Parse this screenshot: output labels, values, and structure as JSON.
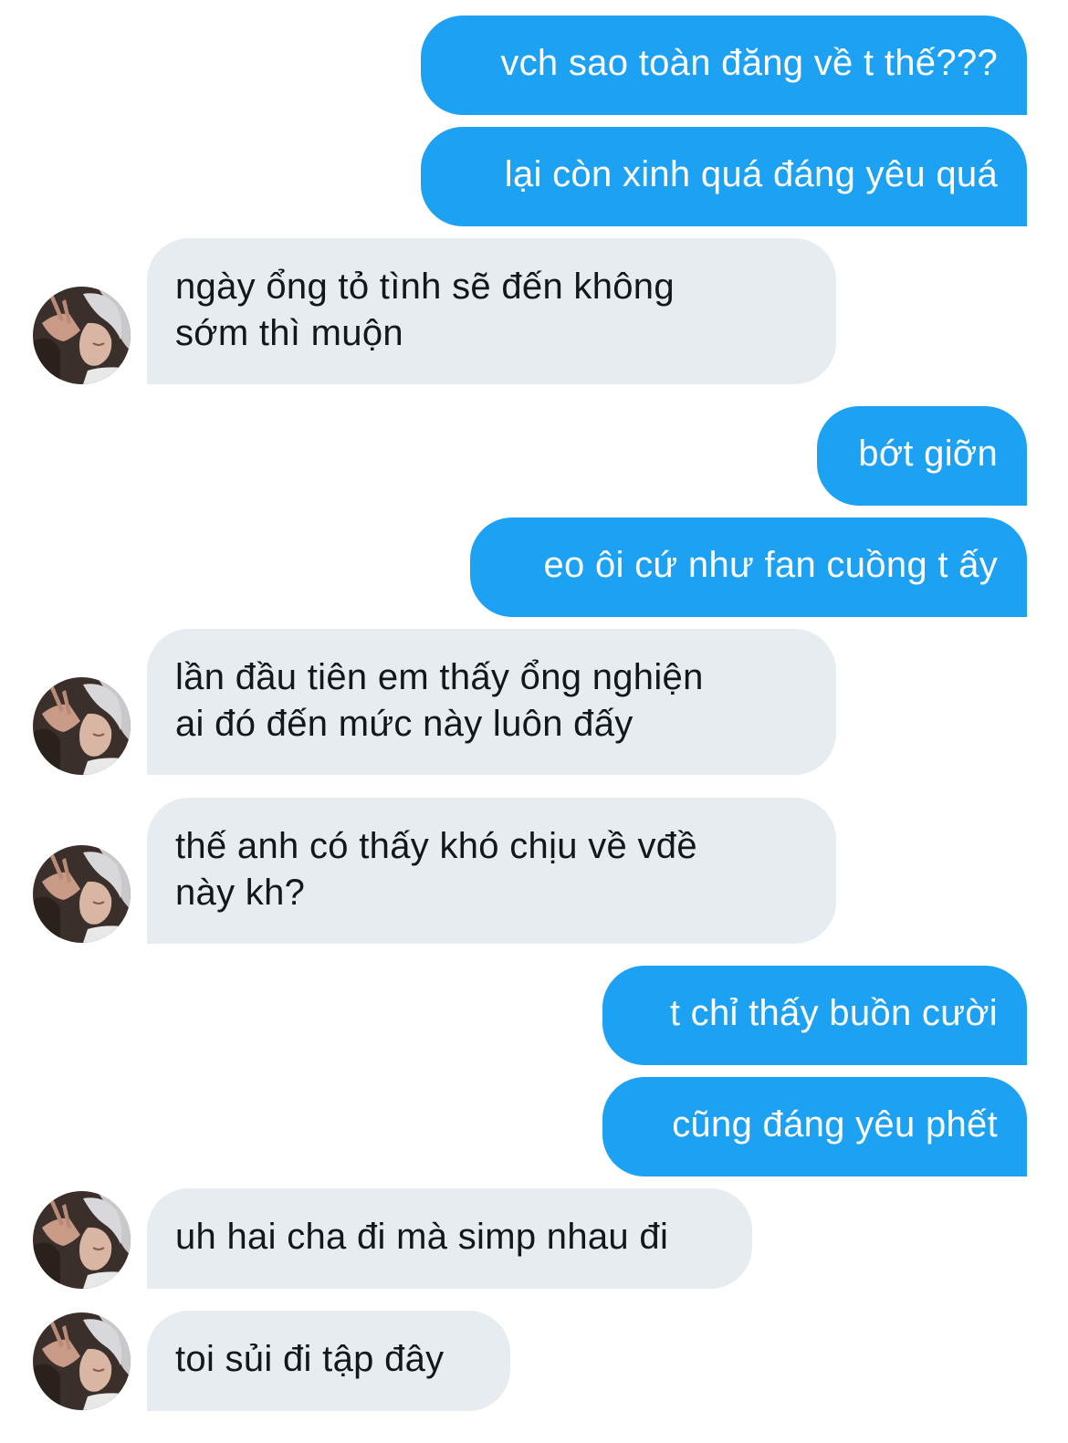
{
  "conversation": {
    "messages": [
      {
        "from": "me",
        "text": "vch sao toàn đăng về t thế???"
      },
      {
        "from": "me",
        "text": "lại còn xinh quá đáng yêu quá"
      },
      {
        "from": "other",
        "text": "ngày ổng tỏ tình sẽ đến không sớm thì muộn",
        "lines": [
          "ngày ổng tỏ tình sẽ đến không",
          "sớm thì muộn"
        ]
      },
      {
        "from": "me",
        "text": "bớt giỡn"
      },
      {
        "from": "me",
        "text": "eo ôi cứ như fan cuồng t ấy"
      },
      {
        "from": "other",
        "text": "lần đầu tiên em thấy ổng nghiện ai đó đến mức này luôn đấy",
        "lines": [
          "lần đầu tiên em thấy ổng nghiện",
          "ai đó đến mức này luôn đấy"
        ]
      },
      {
        "from": "other",
        "text": "thế anh có thấy khó chịu về vđề này kh?",
        "lines": [
          "thế anh có thấy khó chịu về vđề",
          "này kh?"
        ]
      },
      {
        "from": "me",
        "text": "t chỉ thấy buồn cười"
      },
      {
        "from": "me",
        "text": "cũng đáng yêu phết"
      },
      {
        "from": "other",
        "text": "uh hai cha đi mà simp nhau đi"
      },
      {
        "from": "other",
        "text": "toi sủi đi tập đây"
      }
    ]
  },
  "colors": {
    "outgoing_bubble": "#1da1f2",
    "incoming_bubble": "#e6ecf0",
    "outgoing_text": "#ffffff",
    "incoming_text": "#14171a"
  },
  "icons": {
    "avatar": "user-avatar-photo"
  }
}
